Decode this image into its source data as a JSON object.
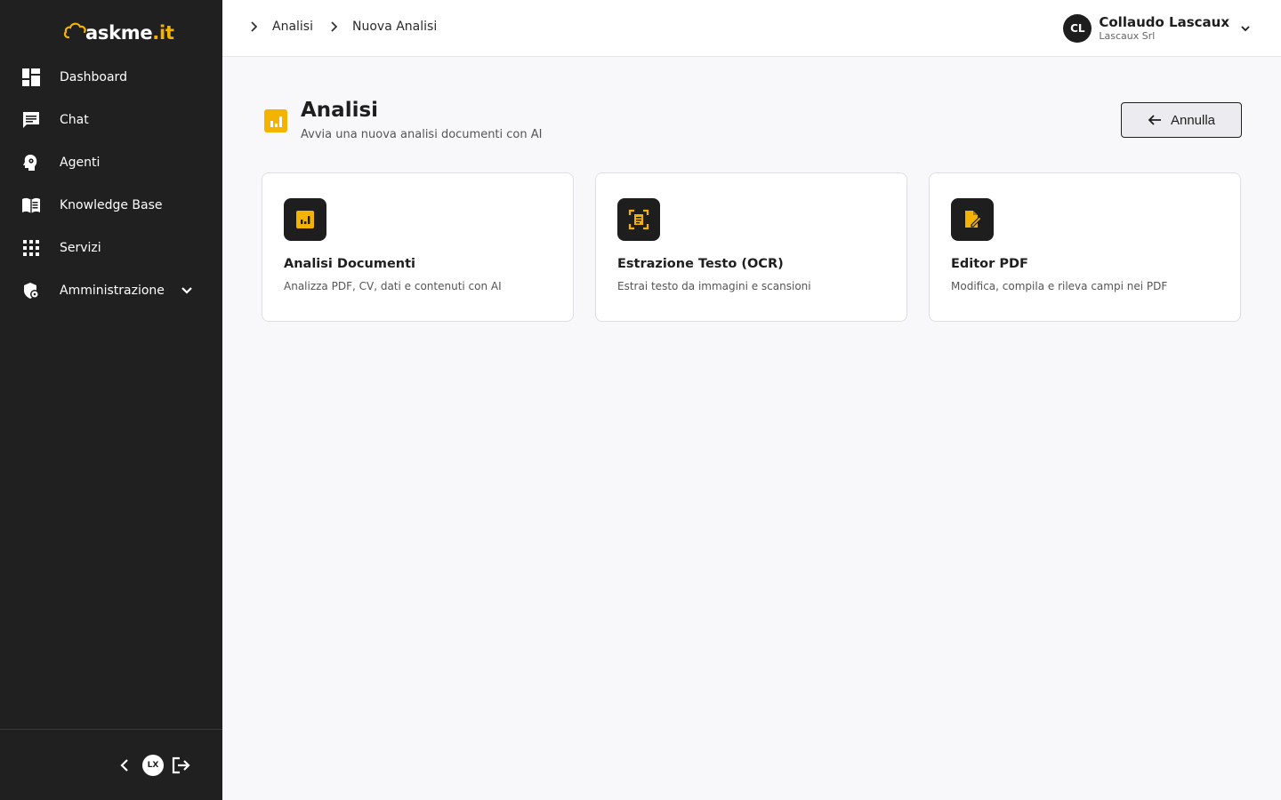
{
  "app": {
    "logo_prefix": "askme",
    "logo_suffix": ".it"
  },
  "sidebar": {
    "items": [
      {
        "label": "Dashboard",
        "icon": "dashboard-icon"
      },
      {
        "label": "Chat",
        "icon": "chat-icon"
      },
      {
        "label": "Agenti",
        "icon": "agent-head-icon"
      },
      {
        "label": "Knowledge Base",
        "icon": "book-icon"
      },
      {
        "label": "Servizi",
        "icon": "grid-icon"
      },
      {
        "label": "Amministrazione",
        "icon": "admin-shield-icon",
        "expandable": true
      }
    ],
    "footer": {
      "collapse_icon": "chevron-left-icon",
      "brand_badge": "LX",
      "logout_icon": "logout-icon"
    }
  },
  "header": {
    "breadcrumb": [
      "Analisi",
      "Nuova Analisi"
    ],
    "user": {
      "initials": "CL",
      "name": "Collaudo Lascaux",
      "org": "Lascaux Srl"
    }
  },
  "main": {
    "title": "Analisi",
    "subtitle": "Avvia una nuova analisi documenti con AI",
    "cancel_label": "Annulla",
    "cards": [
      {
        "title": "Analisi Documenti",
        "desc": "Analizza PDF, CV, dati e contenuti con AI",
        "icon": "analytics-icon"
      },
      {
        "title": "Estrazione Testo (OCR)",
        "desc": "Estrai testo da immagini e scansioni",
        "icon": "ocr-scan-icon"
      },
      {
        "title": "Editor PDF",
        "desc": "Modifica, compila e rileva campi nei PDF",
        "icon": "edit-document-icon"
      }
    ]
  },
  "colors": {
    "sidebar_bg": "#202020",
    "accent": "#f5b301",
    "background": "#f8f8fb"
  }
}
